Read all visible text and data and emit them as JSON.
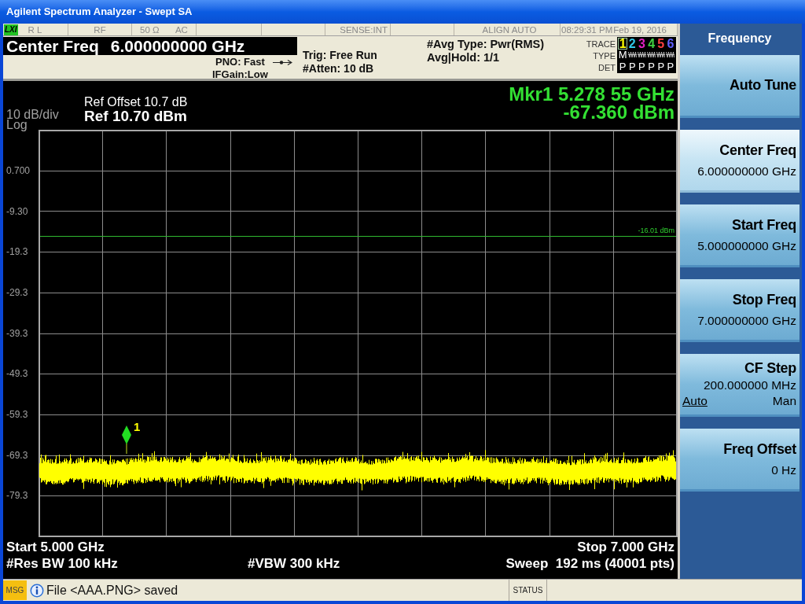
{
  "window": {
    "title": "Agilent Spectrum Analyzer - Swept SA"
  },
  "status_line": {
    "cells": [
      {
        "kind": "text",
        "logo": "LXI",
        "texts": [
          "R L"
        ]
      },
      {
        "kind": "text",
        "texts": [
          "RF"
        ]
      },
      {
        "kind": "text",
        "texts": [
          "50 Ω",
          "AC"
        ]
      },
      {
        "kind": "blank"
      },
      {
        "kind": "blank"
      },
      {
        "kind": "text",
        "texts": [
          "SENSE:INT"
        ]
      },
      {
        "kind": "blank"
      },
      {
        "kind": "text",
        "texts": [
          "ALIGN AUTO"
        ]
      },
      {
        "kind": "text",
        "texts": [
          "08:29:31 PM",
          "Feb 19, 2016"
        ]
      }
    ]
  },
  "active_function": {
    "label": "Center Freq",
    "value": "6.000000000 GHz"
  },
  "settings": {
    "pno": "PNO: Fast",
    "if_gain": "IFGain:Low",
    "trigger": "Trig: Free Run",
    "attenuation": "#Atten: 10 dB",
    "avg_type": "#Avg Type: Pwr(RMS)",
    "avg_hold": "Avg|Hold: 1/1"
  },
  "trace_panel": {
    "row_labels": [
      "TRACE",
      "TYPE",
      "DET"
    ],
    "traces": [
      {
        "number": "1",
        "color": "#ffff00",
        "selected": true,
        "kind": "letter",
        "type": "M",
        "detector": "P"
      },
      {
        "number": "2",
        "color": "#30c8e8",
        "selected": false,
        "kind": "wave",
        "detector": "P"
      },
      {
        "number": "3",
        "color": "#e020c0",
        "selected": false,
        "kind": "wave",
        "detector": "P"
      },
      {
        "number": "4",
        "color": "#40d040",
        "selected": false,
        "kind": "wave",
        "detector": "P"
      },
      {
        "number": "5",
        "color": "#ff4040",
        "selected": false,
        "kind": "wave",
        "detector": "P"
      },
      {
        "number": "6",
        "color": "#6060ff",
        "selected": false,
        "kind": "wave",
        "detector": "P"
      }
    ]
  },
  "graph": {
    "ref_offset": "Ref Offset 10.7 dB",
    "ref_level": "Ref 10.70 dBm",
    "scale": "10 dB/div",
    "scale_type": "Log",
    "marker_readout": {
      "frequency": "Mkr1 5.278 55 GHz",
      "amplitude": "-67.360 dBm"
    },
    "y_labels": [
      "0.700",
      "-9.30",
      "-19.3",
      "-29.3",
      "-39.3",
      "-49.3",
      "-59.3",
      "-69.3",
      "-79.3"
    ],
    "display_line": {
      "label": "-16.01 dBm"
    },
    "markers": [
      {
        "label": "1"
      }
    ],
    "start": "Start 5.000 GHz",
    "stop": "Stop 7.000 GHz",
    "res_bw": "#Res BW 100 kHz",
    "vbw": "#VBW 300 kHz",
    "sweep": "Sweep  192 ms (40001 pts)"
  },
  "softkey_menu": {
    "title": "Frequency",
    "keys": [
      {
        "label": "Auto Tune",
        "selected": false
      },
      {
        "label": "Center Freq",
        "value": "6.000000000 GHz",
        "selected": true
      },
      {
        "label": "Start Freq",
        "value": "5.000000000 GHz",
        "selected": false
      },
      {
        "label": "Stop Freq",
        "value": "7.000000000 GHz",
        "selected": false
      },
      {
        "label": "CF Step",
        "value": "200.000000 MHz",
        "selected": false,
        "options": [
          {
            "label": "Auto",
            "selected": true
          },
          {
            "label": "Man",
            "selected": false
          }
        ]
      },
      {
        "label": "Freq Offset",
        "value": "0 Hz",
        "selected": false
      }
    ]
  },
  "message_bar": {
    "tag": "MSG",
    "message": "File <AAA.PNG> saved",
    "status": "STATUS"
  }
}
